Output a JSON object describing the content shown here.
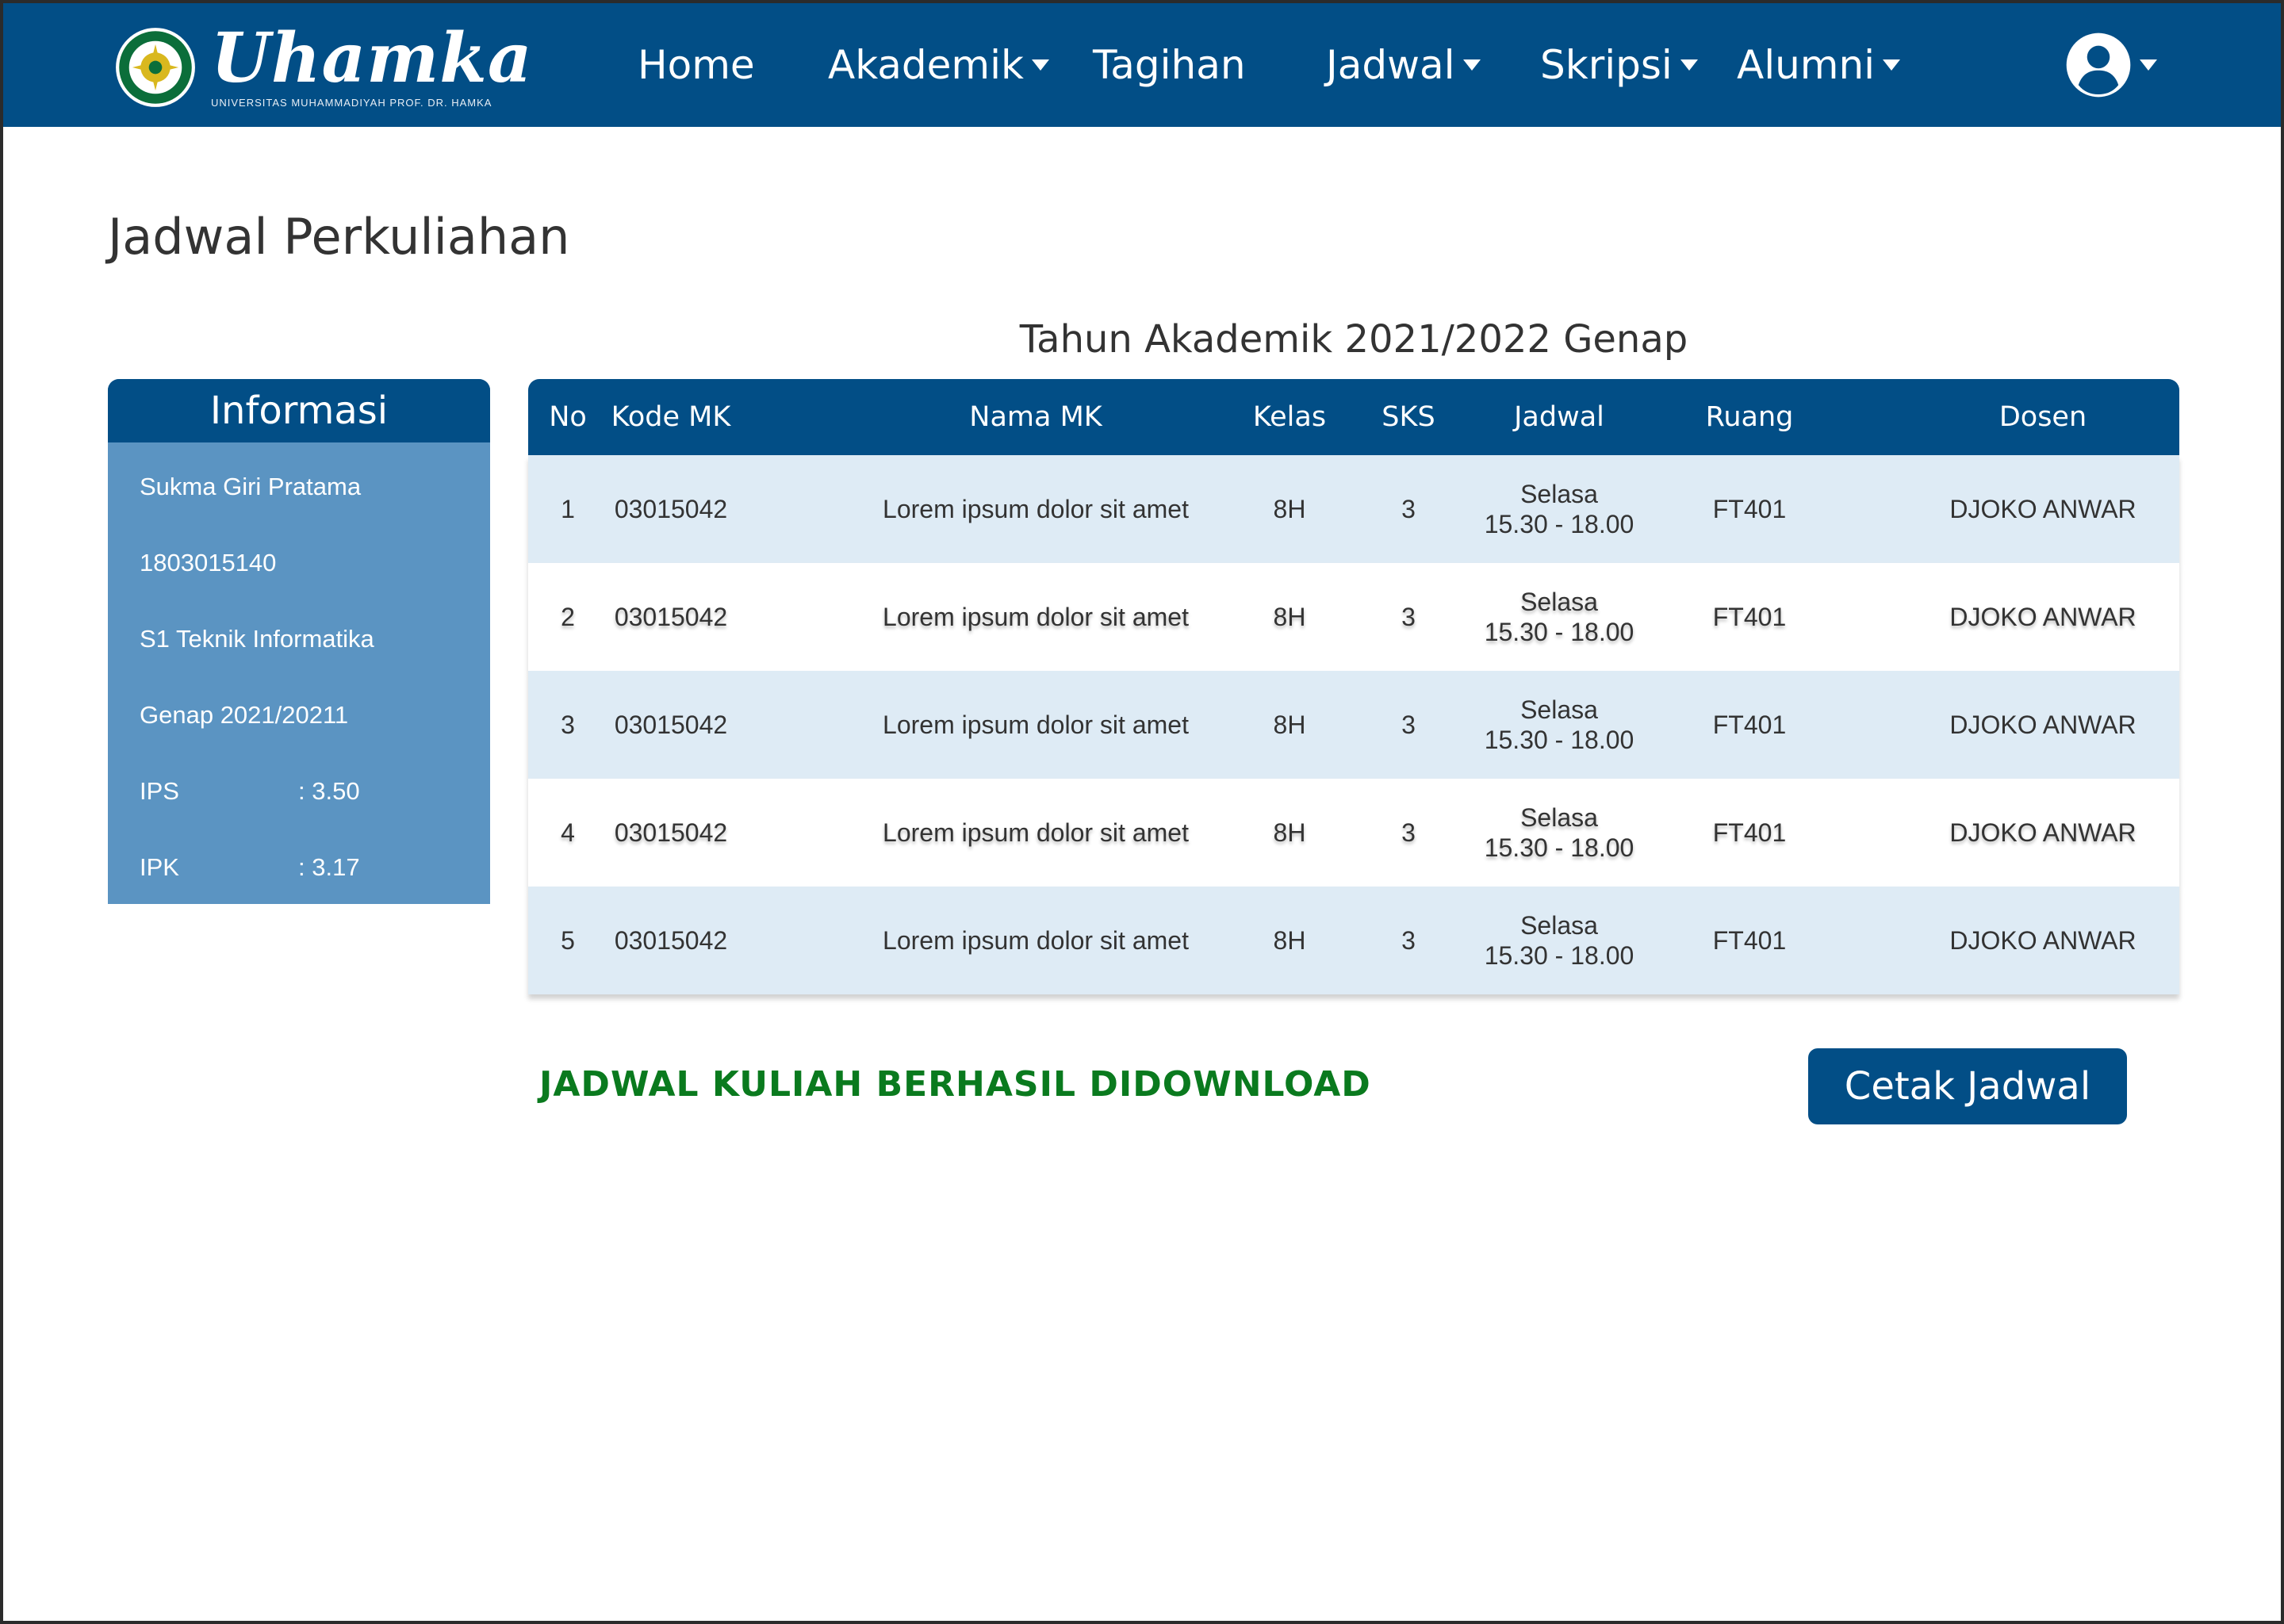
{
  "brand": {
    "name": "Uhamka",
    "subtitle": "UNIVERSITAS MUHAMMADIYAH PROF. DR. HAMKA",
    "colors": {
      "primary": "#024e86",
      "panel": "#5b94c2",
      "row_shade": "#deebf5",
      "success": "#0a7a1e"
    }
  },
  "nav": {
    "items": [
      {
        "label": "Home",
        "has_dropdown": false
      },
      {
        "label": "Akademik",
        "has_dropdown": true
      },
      {
        "label": "Tagihan",
        "has_dropdown": false
      },
      {
        "label": "Jadwal",
        "has_dropdown": true
      },
      {
        "label": "Skripsi",
        "has_dropdown": true
      },
      {
        "label": "Alumni",
        "has_dropdown": true
      }
    ],
    "profile_icon": "user-circle-icon"
  },
  "page": {
    "title": "Jadwal Perkuliahan"
  },
  "info_panel": {
    "heading": "Informasi",
    "name": "Sukma Giri Pratama",
    "nim": "1803015140",
    "program": "S1 Teknik Informatika",
    "semester": "Genap 2021/20211",
    "ips": {
      "label": "IPS",
      "value": ": 3.50"
    },
    "ipk": {
      "label": "IPK",
      "value": ": 3.17"
    }
  },
  "schedule": {
    "academic_year": "Tahun Akademik 2021/2022 Genap",
    "columns": [
      "No",
      "Kode MK",
      "Nama MK",
      "Kelas",
      "SKS",
      "Jadwal",
      "Ruang",
      "Dosen"
    ],
    "rows": [
      {
        "no": "1",
        "kode": "03015042",
        "nama": "Lorem ipsum dolor sit amet",
        "kelas": "8H",
        "sks": "3",
        "hari": "Selasa",
        "jam": "15.30 - 18.00",
        "ruang": "FT401",
        "dosen": "DJOKO ANWAR"
      },
      {
        "no": "2",
        "kode": "03015042",
        "nama": "Lorem ipsum dolor sit amet",
        "kelas": "8H",
        "sks": "3",
        "hari": "Selasa",
        "jam": "15.30 - 18.00",
        "ruang": "FT401",
        "dosen": "DJOKO ANWAR"
      },
      {
        "no": "3",
        "kode": "03015042",
        "nama": "Lorem ipsum dolor sit amet",
        "kelas": "8H",
        "sks": "3",
        "hari": "Selasa",
        "jam": "15.30 - 18.00",
        "ruang": "FT401",
        "dosen": "DJOKO ANWAR"
      },
      {
        "no": "4",
        "kode": "03015042",
        "nama": "Lorem ipsum dolor sit amet",
        "kelas": "8H",
        "sks": "3",
        "hari": "Selasa",
        "jam": "15.30 - 18.00",
        "ruang": "FT401",
        "dosen": "DJOKO ANWAR"
      },
      {
        "no": "5",
        "kode": "03015042",
        "nama": "Lorem ipsum dolor sit amet",
        "kelas": "8H",
        "sks": "3",
        "hari": "Selasa",
        "jam": "15.30 - 18.00",
        "ruang": "FT401",
        "dosen": "DJOKO ANWAR"
      }
    ]
  },
  "status": {
    "message": "JADWAL KULIAH BERHASIL DIDOWNLOAD"
  },
  "actions": {
    "print_label": "Cetak Jadwal"
  }
}
